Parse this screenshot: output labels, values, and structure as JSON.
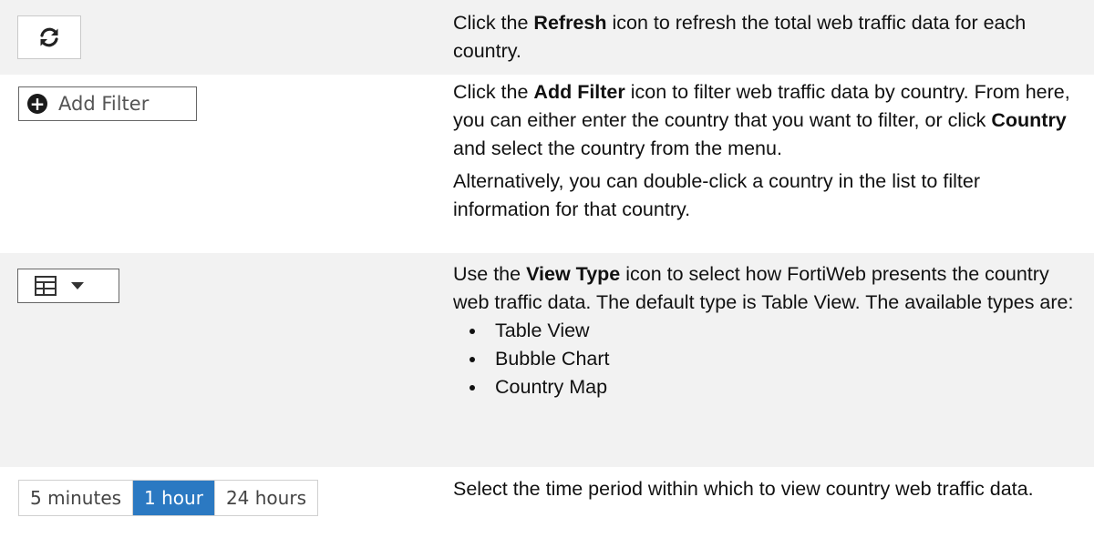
{
  "rows": [
    {
      "control": {
        "icon": "refresh-icon"
      },
      "desc": {
        "pre": "Click the ",
        "bold": "Refresh",
        "post": " icon to refresh the total web traffic data for each country."
      }
    },
    {
      "control": {
        "icon": "plus-circle-icon",
        "label": "Add Filter"
      },
      "desc": {
        "p1_pre": "Click the ",
        "p1_bold": "Add Filter",
        "p1_mid": " icon to filter web traffic data by country. From here, you can either enter the country that you want to filter, or click ",
        "p1_bold2": "Country",
        "p1_post": " and select the country from the menu.",
        "p2": "Alternatively, you can double-click a country in the list to filter information for that country."
      }
    },
    {
      "control": {
        "icon": "table-icon",
        "caret": "caret-down-icon"
      },
      "desc": {
        "pre": "Use the ",
        "bold": "View Type",
        "post": " icon to select how FortiWeb presents the country web traffic data. The default type is Table View. The available types are:",
        "types": [
          "Table View",
          "Bubble Chart",
          "Country Map"
        ]
      }
    },
    {
      "control": {
        "options": [
          "5 minutes",
          "1 hour",
          "24 hours"
        ],
        "selected": "1 hour"
      },
      "desc": {
        "text": "Select the time period within which to view country web traffic data."
      }
    }
  ]
}
